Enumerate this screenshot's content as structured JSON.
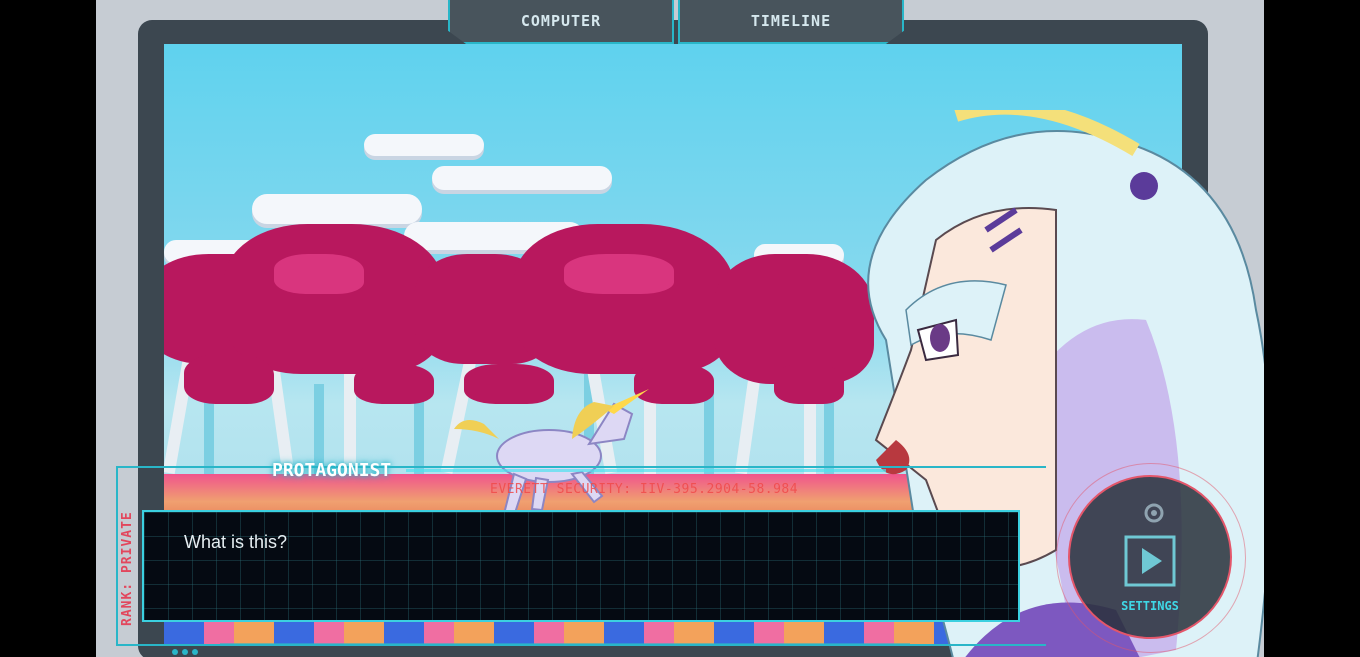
{
  "tabs": {
    "computer": "COMPUTER",
    "timeline": "TIMELINE"
  },
  "dialogue": {
    "speaker": "PROTAGONIST",
    "text": "What is this?",
    "security_line": "EVERETT SECURITY: IIV-395.2904-58.984",
    "rank": "RANK: PRIVATE"
  },
  "controls": {
    "settings_label": "SETTINGS"
  },
  "icons": [
    "play-icon",
    "gear-icon"
  ],
  "colors": {
    "accent": "#29b6c8",
    "alert": "#e2475d",
    "foliage": "#b8185e"
  }
}
